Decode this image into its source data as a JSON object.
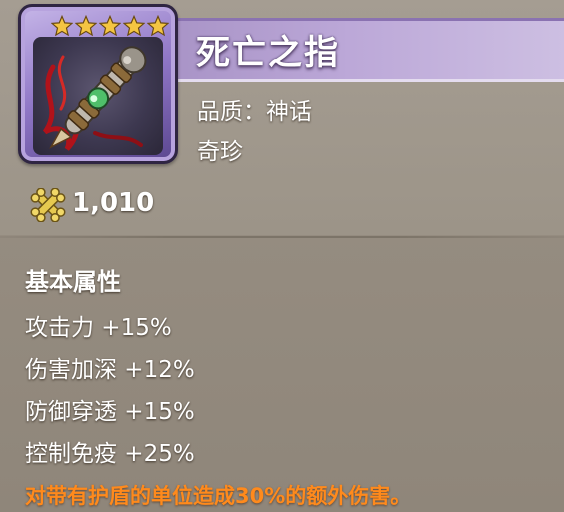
{
  "item": {
    "name": "死亡之指",
    "star_count": 5,
    "quality": "品质：神话",
    "category": "奇珍",
    "icon": "bone-dagger-icon"
  },
  "price": {
    "value": "1,010",
    "icon": "crossed-bones-currency-icon"
  },
  "attributes": {
    "title": "基本属性",
    "stats": [
      "攻击力 +15%",
      "伤害加深 +12%",
      "防御穿透 +15%",
      "控制免疫 +25%"
    ]
  },
  "special_effect": "对带有护盾的单位造成30%的额外伤害。",
  "colors": {
    "name_bar": "#bca8d8",
    "effect_text": "#ff8a1c",
    "star": "#f4c542"
  }
}
